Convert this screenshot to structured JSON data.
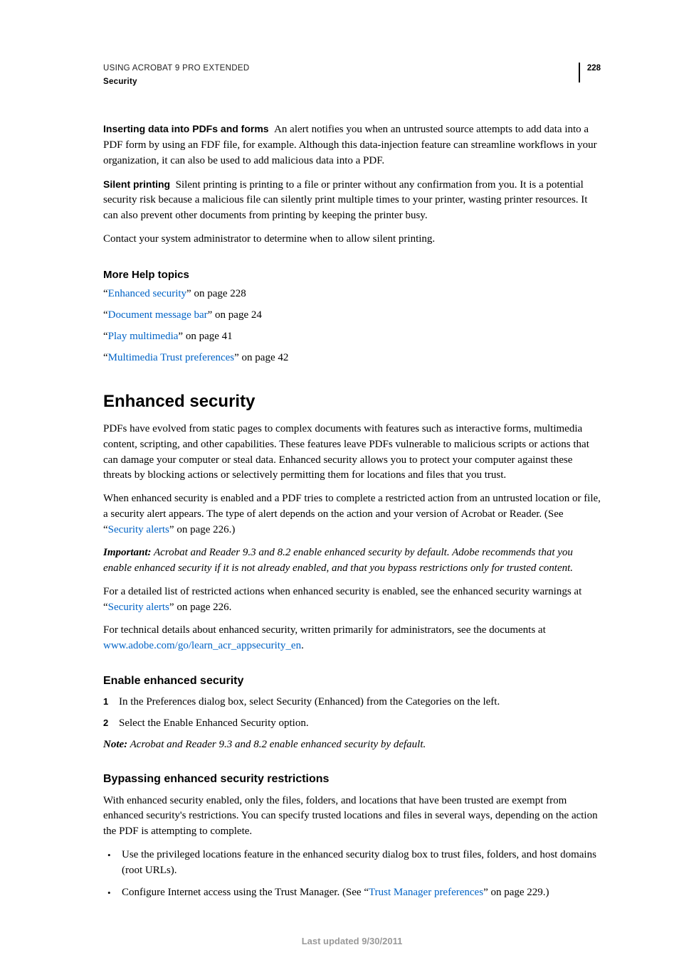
{
  "header": {
    "title": "USING ACROBAT 9 PRO EXTENDED",
    "section": "Security",
    "page_number": "228"
  },
  "para1": {
    "runin": "Inserting data into PDFs and forms",
    "body": "An alert notifies you when an untrusted source attempts to add data into a PDF form by using an FDF file, for example. Although this data-injection feature can streamline workflows in your organization, it can also be used to add malicious data into a PDF."
  },
  "para2": {
    "runin": "Silent printing",
    "body": "Silent printing is printing to a file or printer without any confirmation from you. It is a potential security risk because a malicious file can silently print multiple times to your printer, wasting printer resources. It can also prevent other documents from printing by keeping the printer busy."
  },
  "para3": "Contact your system administrator to determine when to allow silent printing.",
  "more_help": {
    "heading": "More Help topics",
    "items": [
      {
        "link": "Enhanced security",
        "suffix": "” on page 228"
      },
      {
        "link": "Document message bar",
        "suffix": "” on page 24"
      },
      {
        "link": "Play multimedia",
        "suffix": "” on page 41"
      },
      {
        "link": "Multimedia Trust preferences",
        "suffix": "” on page 42"
      }
    ]
  },
  "enhanced": {
    "h1": "Enhanced security",
    "p1": "PDFs have evolved from static pages to complex documents with features such as interactive forms, multimedia content, scripting, and other capabilities. These features leave PDFs vulnerable to malicious scripts or actions that can damage your computer or steal data. Enhanced security allows you to protect your computer against these threats by blocking actions or selectively permitting them for locations and files that you trust.",
    "p2_pre": "When enhanced security is enabled and a PDF tries to complete a restricted action from an untrusted location or file, a security alert appears. The type of alert depends on the action and your version of Acrobat or Reader. (See “",
    "p2_link": "Security alerts",
    "p2_post": "” on page 226.)",
    "important_label": "Important:",
    "important_body": "Acrobat and Reader 9.3 and 8.2 enable enhanced security by default. Adobe recommends that you enable enhanced security if it is not already enabled, and that you bypass restrictions only for trusted content.",
    "p4_pre": "For a detailed list of restricted actions when enhanced security is enabled, see the enhanced security warnings at “",
    "p4_link": "Security alerts",
    "p4_post": "” on page 226.",
    "p5_pre": "For technical details about enhanced security, written primarily for administrators, see the documents at ",
    "p5_link": "www.adobe.com/go/learn_acr_appsecurity_en",
    "p5_post": "."
  },
  "enable": {
    "h2": "Enable enhanced security",
    "steps": [
      "In the Preferences dialog box, select Security (Enhanced) from the Categories on the left.",
      "Select the Enable Enhanced Security option."
    ],
    "note_label": "Note:",
    "note_body": "Acrobat and Reader 9.3 and 8.2 enable enhanced security by default."
  },
  "bypass": {
    "h2": "Bypassing enhanced security restrictions",
    "p1": "With enhanced security enabled, only the files, folders, and locations that have been trusted are exempt from enhanced security's restrictions. You can specify trusted locations and files in several ways, depending on the action the PDF is attempting to complete.",
    "b1": "Use the privileged locations feature in the enhanced security dialog box to trust files, folders, and host domains (root URLs).",
    "b2_pre": "Configure Internet access using the Trust Manager. (See “",
    "b2_link": "Trust Manager preferences",
    "b2_post": "” on page 229.)"
  },
  "footer": "Last updated 9/30/2011"
}
